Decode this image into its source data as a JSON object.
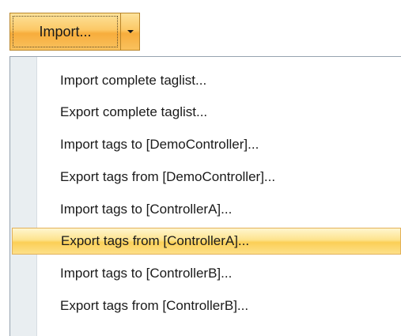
{
  "split_button": {
    "label": "Import..."
  },
  "menu": {
    "highlighted_index": 5,
    "items": [
      {
        "label": "Import complete taglist..."
      },
      {
        "label": "Export complete taglist..."
      },
      {
        "label": "Import tags to [DemoController]..."
      },
      {
        "label": "Export tags from [DemoController]..."
      },
      {
        "label": "Import tags to [ControllerA]..."
      },
      {
        "label": "Export tags from [ControllerA]..."
      },
      {
        "label": "Import tags to [ControllerB]..."
      },
      {
        "label": "Export tags from [ControllerB]..."
      }
    ]
  },
  "icons": {
    "dropdown": "chevron-down-icon"
  },
  "colors": {
    "button_accent": "#f7ad3c",
    "highlight": "#fbcf56",
    "menu_gutter": "#e9eef1"
  }
}
